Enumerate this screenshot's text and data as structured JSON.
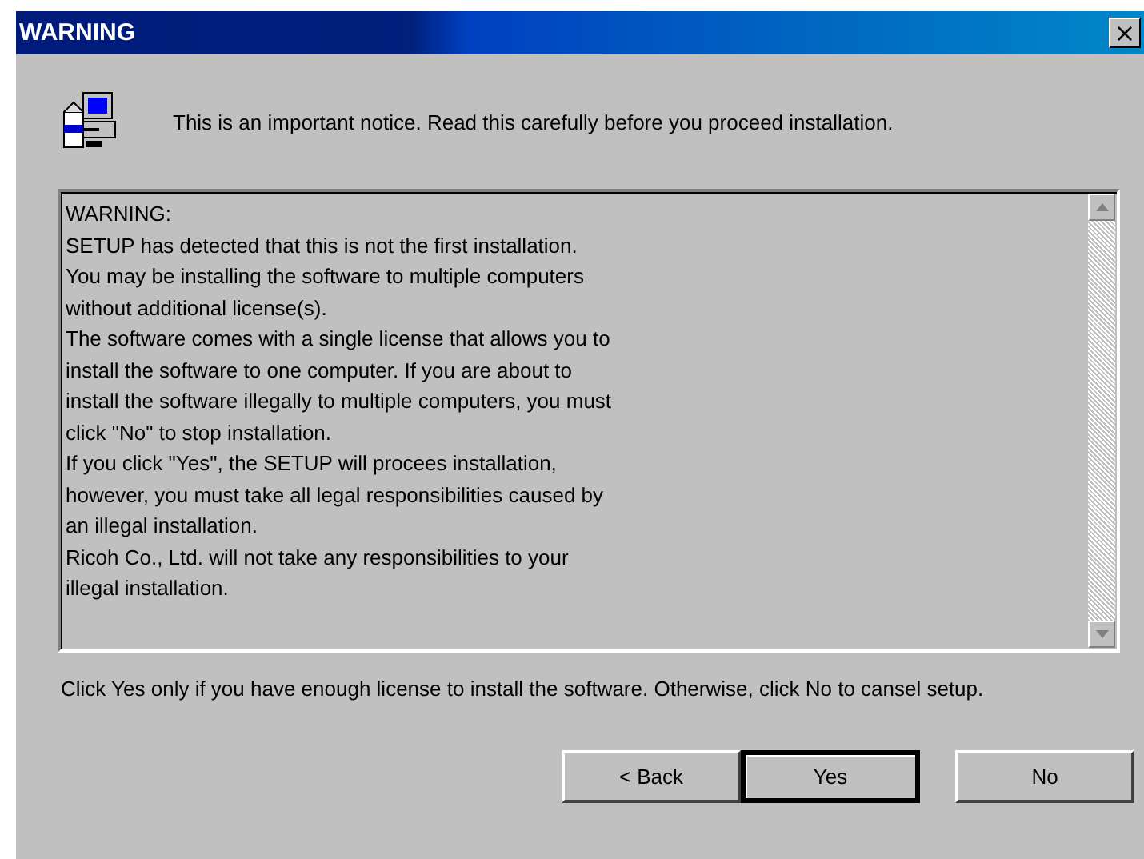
{
  "window": {
    "title": "WARNING",
    "close_glyph": "×"
  },
  "notice": "This is an important notice. Read this carefully before you proceed installation.",
  "text_box": {
    "lines": [
      "WARNING:",
      "SETUP has detected that this is not the first installation.",
      "You may be installing the software to multiple computers",
      "without additional license(s).",
      "The software comes with a single license that allows you to",
      "install the software to one computer. If you are about to",
      "install the software illegally to multiple computers, you must",
      "click \"No\" to stop installation.",
      "If you click \"Yes\", the SETUP will procees installation,",
      "however, you must take all legal responsibilities caused by",
      "an illegal installation.",
      "Ricoh Co., Ltd. will not take any responsibilities to your",
      "illegal installation."
    ]
  },
  "instruction": "Click Yes only if you have enough license to install the software. Otherwise, click No to cansel setup.",
  "buttons": [
    {
      "label": "< Back",
      "default": false
    },
    {
      "label": "Yes",
      "default": true
    },
    {
      "label": "No",
      "default": false
    }
  ]
}
